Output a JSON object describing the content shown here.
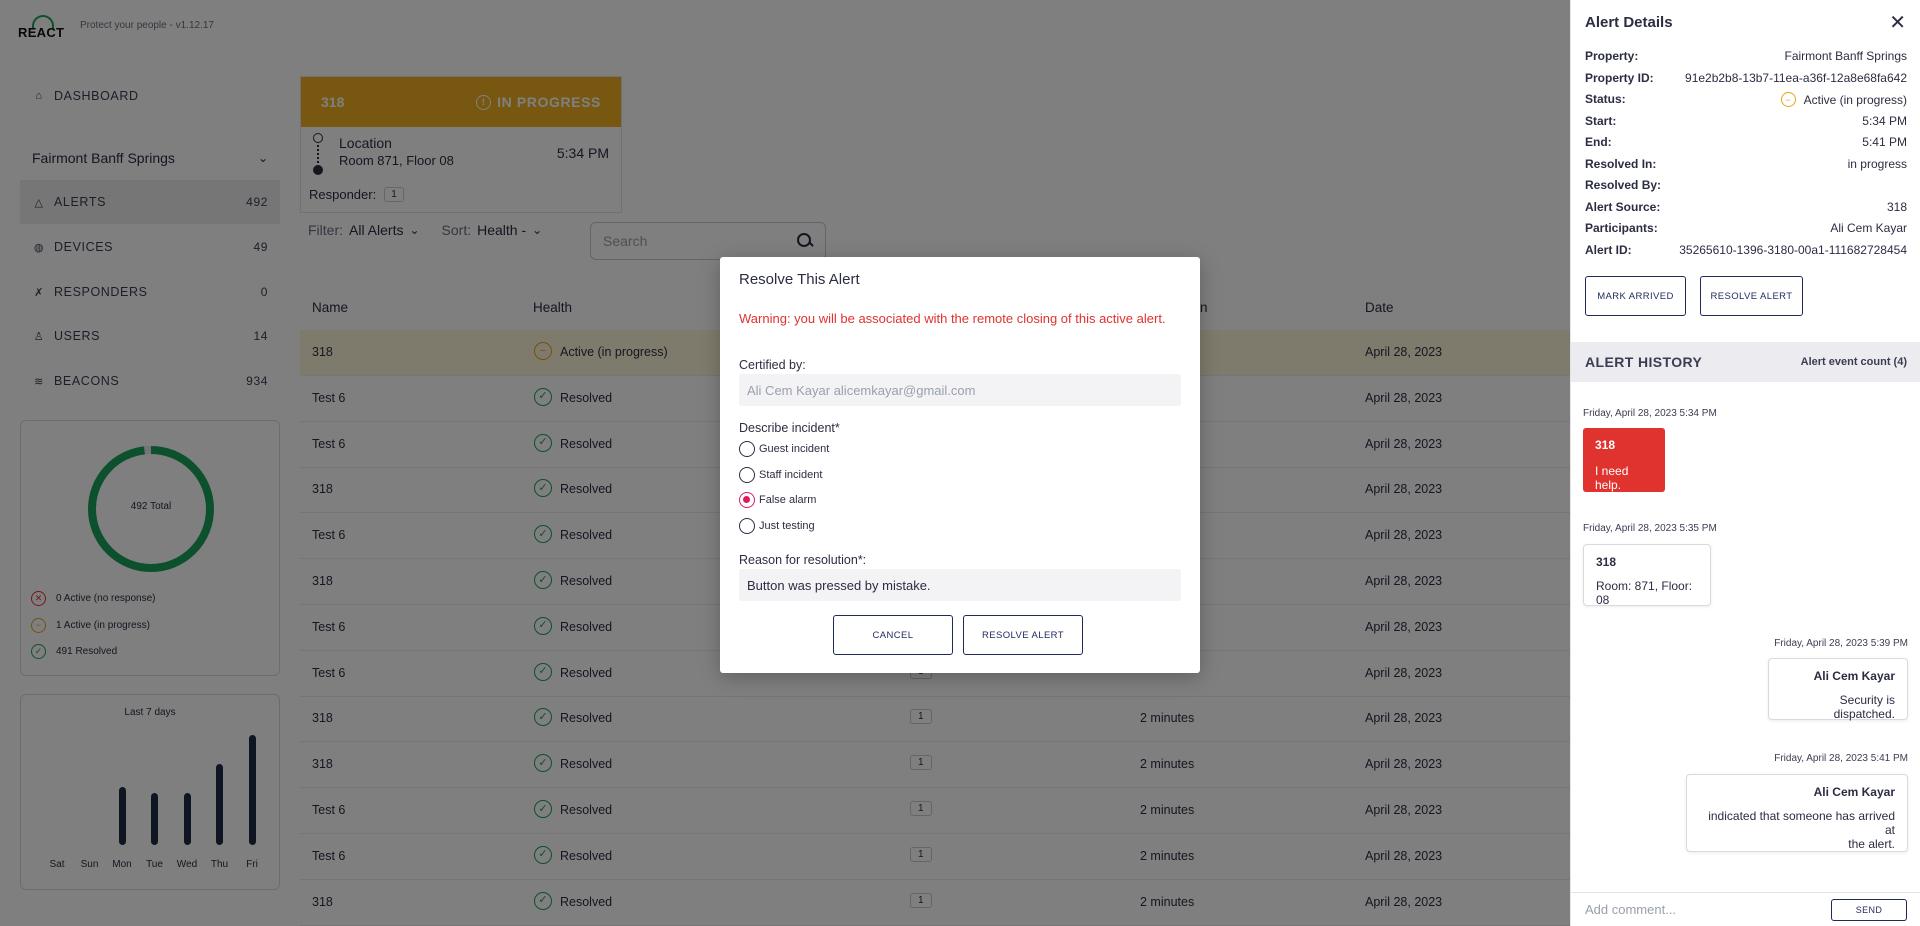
{
  "app": {
    "logo_text": "REACT",
    "tagline": "Protect your people - v1.12.17"
  },
  "sidebar": {
    "dashboard_label": "DASHBOARD",
    "property_name": "Fairmont Banff Springs",
    "items": [
      {
        "label": "ALERTS",
        "count": "492",
        "icon": "bell-icon",
        "active": true
      },
      {
        "label": "DEVICES",
        "count": "49",
        "icon": "device-icon",
        "active": false
      },
      {
        "label": "RESPONDERS",
        "count": "0",
        "icon": "runner-icon",
        "active": false
      },
      {
        "label": "USERS",
        "count": "14",
        "icon": "user-icon",
        "active": false
      },
      {
        "label": "BEACONS",
        "count": "934",
        "icon": "beacon-icon",
        "active": false
      }
    ],
    "summary": {
      "total_label": "492 Total",
      "legend": [
        {
          "label": "0 Active (no response)",
          "type": "danger",
          "color": "#e0322e"
        },
        {
          "label": "1 Active (in progress)",
          "type": "progress",
          "color": "#e8a21a"
        },
        {
          "label": "491 Resolved",
          "type": "ok",
          "color": "#1aa15b"
        }
      ],
      "resolved_fraction": 0.998
    },
    "weekly": {
      "title": "Last 7 days"
    }
  },
  "chart_data": {
    "type": "bar",
    "title": "Last 7 days",
    "categories": [
      "Sat",
      "Sun",
      "Mon",
      "Tue",
      "Wed",
      "Thu",
      "Fri"
    ],
    "values": [
      0,
      0,
      30,
      27,
      27,
      42,
      57
    ],
    "ylim": [
      0,
      60
    ],
    "color": "#1f2a44"
  },
  "alert_card": {
    "name": "318",
    "state": "IN PROGRESS",
    "location_title": "Location",
    "location": "Room 871, Floor 08",
    "time": "5:34 PM",
    "responder_label": "Responder:",
    "responder_count": "1"
  },
  "filters": {
    "filter_label": "Filter:",
    "filter_value": "All Alerts",
    "sort_label": "Sort:",
    "sort_value": "Health -",
    "search_placeholder": "Search"
  },
  "table": {
    "headers": [
      "Name",
      "Health",
      "n",
      "Date"
    ],
    "rows": [
      {
        "name": "318",
        "health": "Active (in progress)",
        "status": "progress",
        "responders": "",
        "duration": "s",
        "date": "April 28, 2023",
        "highlight": true
      },
      {
        "name": "Test 6",
        "health": "Resolved",
        "status": "ok",
        "responders": "",
        "duration": "s",
        "date": "April 28, 2023"
      },
      {
        "name": "Test 6",
        "health": "Resolved",
        "status": "ok",
        "responders": "",
        "duration": "s",
        "date": "April 28, 2023"
      },
      {
        "name": "318",
        "health": "Resolved",
        "status": "ok",
        "responders": "",
        "duration": "ur",
        "date": "April 28, 2023"
      },
      {
        "name": "Test 6",
        "health": "Resolved",
        "status": "ok",
        "responders": "",
        "duration": "ur",
        "date": "April 28, 2023"
      },
      {
        "name": "318",
        "health": "Resolved",
        "status": "ok",
        "responders": "",
        "duration": "s",
        "date": "April 28, 2023"
      },
      {
        "name": "Test 6",
        "health": "Resolved",
        "status": "ok",
        "responders": "",
        "duration": "s",
        "date": "April 28, 2023"
      },
      {
        "name": "Test 6",
        "health": "Resolved",
        "status": "ok",
        "responders": "1",
        "duration": "",
        "date": "April 28, 2023"
      },
      {
        "name": "318",
        "health": "Resolved",
        "status": "ok",
        "responders": "1",
        "duration": "2 minutes",
        "date": "April 28, 2023"
      },
      {
        "name": "318",
        "health": "Resolved",
        "status": "ok",
        "responders": "1",
        "duration": "2 minutes",
        "date": "April 28, 2023"
      },
      {
        "name": "Test 6",
        "health": "Resolved",
        "status": "ok",
        "responders": "1",
        "duration": "2 minutes",
        "date": "April 28, 2023"
      },
      {
        "name": "Test 6",
        "health": "Resolved",
        "status": "ok",
        "responders": "1",
        "duration": "2 minutes",
        "date": "April 28, 2023"
      },
      {
        "name": "318",
        "health": "Resolved",
        "status": "ok",
        "responders": "1",
        "duration": "2 minutes",
        "date": "April 28, 2023"
      }
    ]
  },
  "details": {
    "title": "Alert Details",
    "rows": [
      {
        "key": "Property:",
        "value": "Fairmont Banff Springs"
      },
      {
        "key": "Property ID:",
        "value": "91e2b2b8-13b7-11ea-a36f-12a8e68fa642"
      },
      {
        "key": "Status:",
        "value": "Active (in progress)",
        "status": true
      },
      {
        "key": "Start:",
        "value": "5:34 PM"
      },
      {
        "key": "End:",
        "value": "5:41 PM"
      },
      {
        "key": "Resolved In:",
        "value": "in progress"
      },
      {
        "key": "Resolved By:",
        "value": ""
      },
      {
        "key": "Alert Source:",
        "value": "318"
      },
      {
        "key": "Participants:",
        "value": "Ali Cem Kayar"
      },
      {
        "key": "Alert ID:",
        "value": "35265610-1396-3180-00a1-111682728454"
      }
    ],
    "mark_arrived_label": "MARK ARRIVED",
    "resolve_label": "RESOLVE ALERT"
  },
  "history": {
    "title": "ALERT HISTORY",
    "count_label": "Alert event count (4)",
    "events": [
      {
        "time": "Friday, April 28, 2023 5:34 PM",
        "title": "318",
        "body": "I need help."
      },
      {
        "time": "Friday, April 28, 2023 5:35 PM",
        "title": "318",
        "body": "Room: 871, Floor: 08"
      },
      {
        "time": "Friday, April 28, 2023 5:39 PM",
        "title": "Ali Cem Kayar",
        "body": "Security is dispatched."
      },
      {
        "time": "Friday, April 28, 2023 5:41 PM",
        "title": "Ali Cem Kayar",
        "body_line1": "indicated that someone has arrived at",
        "body_line2": "the alert."
      }
    ],
    "comment_placeholder": "Add comment...",
    "send_label": "SEND"
  },
  "modal": {
    "title": "Resolve This Alert",
    "warning": "Warning: you will be associated with the remote closing of this active alert.",
    "certified_label": "Certified by:",
    "certified_value": "Ali Cem Kayar alicemkayar@gmail.com",
    "describe_label": "Describe incident*",
    "options": [
      "Guest incident",
      "Staff incident",
      "False alarm",
      "Just testing"
    ],
    "selected_option": "False alarm",
    "reason_label": "Reason for resolution*:",
    "reason_value": "Button was pressed by mistake.",
    "cancel_label": "CANCEL",
    "resolve_label": "RESOLVE ALERT",
    "accent": "#e0195f",
    "warning_color": "#e0322e"
  }
}
